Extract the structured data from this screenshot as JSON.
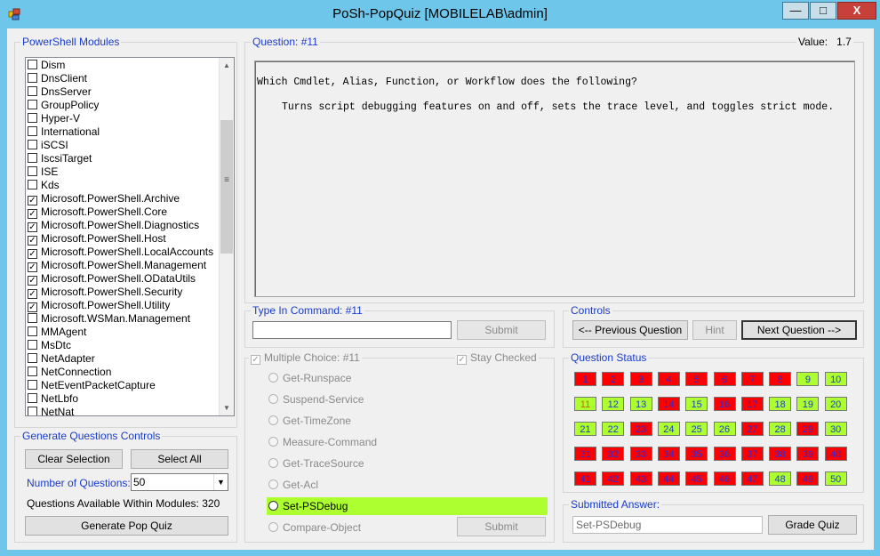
{
  "window": {
    "title": "PoSh-PopQuiz   [MOBILELAB\\admin]",
    "minimize": "—",
    "maximize": "□",
    "close": "X"
  },
  "modules": {
    "legend": "PowerShell Modules",
    "items": [
      {
        "label": "Dism",
        "checked": false
      },
      {
        "label": "DnsClient",
        "checked": false
      },
      {
        "label": "DnsServer",
        "checked": false
      },
      {
        "label": "GroupPolicy",
        "checked": false
      },
      {
        "label": "Hyper-V",
        "checked": false
      },
      {
        "label": "International",
        "checked": false
      },
      {
        "label": "iSCSI",
        "checked": false
      },
      {
        "label": "IscsiTarget",
        "checked": false
      },
      {
        "label": "ISE",
        "checked": false
      },
      {
        "label": "Kds",
        "checked": false
      },
      {
        "label": "Microsoft.PowerShell.Archive",
        "checked": true
      },
      {
        "label": "Microsoft.PowerShell.Core",
        "checked": true
      },
      {
        "label": "Microsoft.PowerShell.Diagnostics",
        "checked": true
      },
      {
        "label": "Microsoft.PowerShell.Host",
        "checked": true
      },
      {
        "label": "Microsoft.PowerShell.LocalAccounts",
        "checked": true
      },
      {
        "label": "Microsoft.PowerShell.Management",
        "checked": true
      },
      {
        "label": "Microsoft.PowerShell.ODataUtils",
        "checked": true
      },
      {
        "label": "Microsoft.PowerShell.Security",
        "checked": true
      },
      {
        "label": "Microsoft.PowerShell.Utility",
        "checked": true
      },
      {
        "label": "Microsoft.WSMan.Management",
        "checked": false
      },
      {
        "label": "MMAgent",
        "checked": false
      },
      {
        "label": "MsDtc",
        "checked": false
      },
      {
        "label": "NetAdapter",
        "checked": false
      },
      {
        "label": "NetConnection",
        "checked": false
      },
      {
        "label": "NetEventPacketCapture",
        "checked": false
      },
      {
        "label": "NetLbfo",
        "checked": false
      },
      {
        "label": "NetNat",
        "checked": false
      }
    ]
  },
  "generate": {
    "legend": "Generate Questions Controls",
    "clear_label": "Clear Selection",
    "select_all_label": "Select All",
    "num_questions_label": "Number of Questions:",
    "num_questions_value": "50",
    "available_text": "Questions Available Within Modules: 320",
    "generate_label": "Generate Pop Quiz"
  },
  "question": {
    "legend": "Question: #11",
    "value_label": "Value:",
    "value": "1.7",
    "prompt": "Which Cmdlet, Alias, Function, or Workflow does the following?",
    "description": "Turns script debugging features on and off, sets the trace level, and toggles strict mode."
  },
  "type_in": {
    "legend": "Type In Command: #11",
    "value": "",
    "submit_label": "Submit"
  },
  "controls": {
    "legend": "Controls",
    "prev_label": "<-- Previous Question",
    "hint_label": "Hint",
    "next_label": "Next Question -->"
  },
  "multiple_choice": {
    "legend": "Multiple Choice: #11",
    "stay_checked_label": "Stay Checked",
    "options": [
      "Get-Runspace",
      "Suspend-Service",
      "Get-TimeZone",
      "Measure-Command",
      "Get-TraceSource",
      "Get-Acl",
      "Set-PSDebug",
      "Compare-Object"
    ],
    "selected_index": 6,
    "submit_label": "Submit"
  },
  "status": {
    "legend": "Question Status",
    "cells": [
      {
        "n": "1",
        "state": "red"
      },
      {
        "n": "2",
        "state": "red"
      },
      {
        "n": "3",
        "state": "red"
      },
      {
        "n": "4",
        "state": "red"
      },
      {
        "n": "5",
        "state": "red"
      },
      {
        "n": "6",
        "state": "red"
      },
      {
        "n": "7",
        "state": "red"
      },
      {
        "n": "8",
        "state": "red"
      },
      {
        "n": "9",
        "state": "green"
      },
      {
        "n": "10",
        "state": "green"
      },
      {
        "n": "11",
        "state": "green",
        "accent": "#c46a00"
      },
      {
        "n": "12",
        "state": "green"
      },
      {
        "n": "13",
        "state": "green"
      },
      {
        "n": "14",
        "state": "red"
      },
      {
        "n": "15",
        "state": "green"
      },
      {
        "n": "16",
        "state": "red"
      },
      {
        "n": "17",
        "state": "red"
      },
      {
        "n": "18",
        "state": "green"
      },
      {
        "n": "19",
        "state": "green"
      },
      {
        "n": "20",
        "state": "green"
      },
      {
        "n": "21",
        "state": "green"
      },
      {
        "n": "22",
        "state": "green"
      },
      {
        "n": "23",
        "state": "red"
      },
      {
        "n": "24",
        "state": "green"
      },
      {
        "n": "25",
        "state": "green"
      },
      {
        "n": "26",
        "state": "green"
      },
      {
        "n": "27",
        "state": "red"
      },
      {
        "n": "28",
        "state": "green"
      },
      {
        "n": "29",
        "state": "red"
      },
      {
        "n": "30",
        "state": "green"
      },
      {
        "n": "31",
        "state": "red"
      },
      {
        "n": "32",
        "state": "red"
      },
      {
        "n": "33",
        "state": "red"
      },
      {
        "n": "34",
        "state": "red"
      },
      {
        "n": "35",
        "state": "red"
      },
      {
        "n": "36",
        "state": "red"
      },
      {
        "n": "37",
        "state": "red"
      },
      {
        "n": "38",
        "state": "red"
      },
      {
        "n": "39",
        "state": "red"
      },
      {
        "n": "40",
        "state": "red"
      },
      {
        "n": "41",
        "state": "red"
      },
      {
        "n": "42",
        "state": "red"
      },
      {
        "n": "43",
        "state": "red"
      },
      {
        "n": "44",
        "state": "red"
      },
      {
        "n": "45",
        "state": "red"
      },
      {
        "n": "46",
        "state": "red"
      },
      {
        "n": "47",
        "state": "red"
      },
      {
        "n": "48",
        "state": "green"
      },
      {
        "n": "49",
        "state": "red"
      },
      {
        "n": "50",
        "state": "green"
      }
    ]
  },
  "submitted": {
    "legend": "Submitted Answer:",
    "value": "Set-PSDebug",
    "grade_label": "Grade Quiz"
  },
  "colors": {
    "accent_legend": "#1a3cc8",
    "status_red": "#ff0000",
    "status_green": "#adff2f",
    "selected_choice": "#adff2f",
    "titlebar": "#6ec6ea"
  }
}
